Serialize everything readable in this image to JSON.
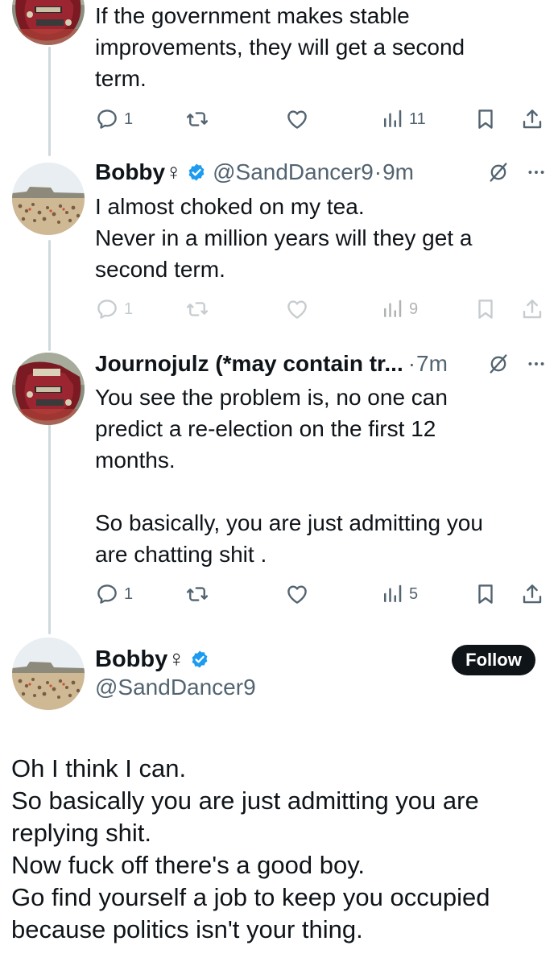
{
  "tweets": [
    {
      "text": "If the government makes stable\nimprovements, they will get a second\nterm.",
      "stats": {
        "replies": "1",
        "views": "11"
      }
    },
    {
      "display_name": "Bobby♀",
      "handle": "@SandDancer9",
      "separator": "·",
      "time": "9m",
      "text": "I almost choked on my tea.\nNever in a million years will they get a\nsecond term.",
      "stats": {
        "replies": "1",
        "views": "9"
      }
    },
    {
      "display_name": "Journojulz (*may contain tr...",
      "separator": "·",
      "time": "7m",
      "text": "You see the problem is, no one can\npredict a re-election on the first 12\nmonths.\n\nSo basically, you are just admitting you\nare chatting shit .",
      "stats": {
        "replies": "1",
        "views": "5"
      }
    }
  ],
  "main_tweet": {
    "display_name": "Bobby♀",
    "handle": "@SandDancer9",
    "follow_label": "Follow",
    "text": "Oh I think I can.\nSo basically you are just admitting you are\nreplying shit.\nNow fuck off there's a good boy.\nGo find yourself a job to keep you occupied\nbecause politics isn't your thing."
  },
  "colors": {
    "text": "#0f1419",
    "secondary": "#536471",
    "verified": "#1d9bf0",
    "thread_line": "#cfd9de",
    "follow_bg": "#0f1419"
  },
  "icons": [
    "reply-icon",
    "retweet-icon",
    "like-icon",
    "views-icon",
    "bookmark-icon",
    "share-icon",
    "verified-badge-icon",
    "grok-icon",
    "more-icon"
  ]
}
